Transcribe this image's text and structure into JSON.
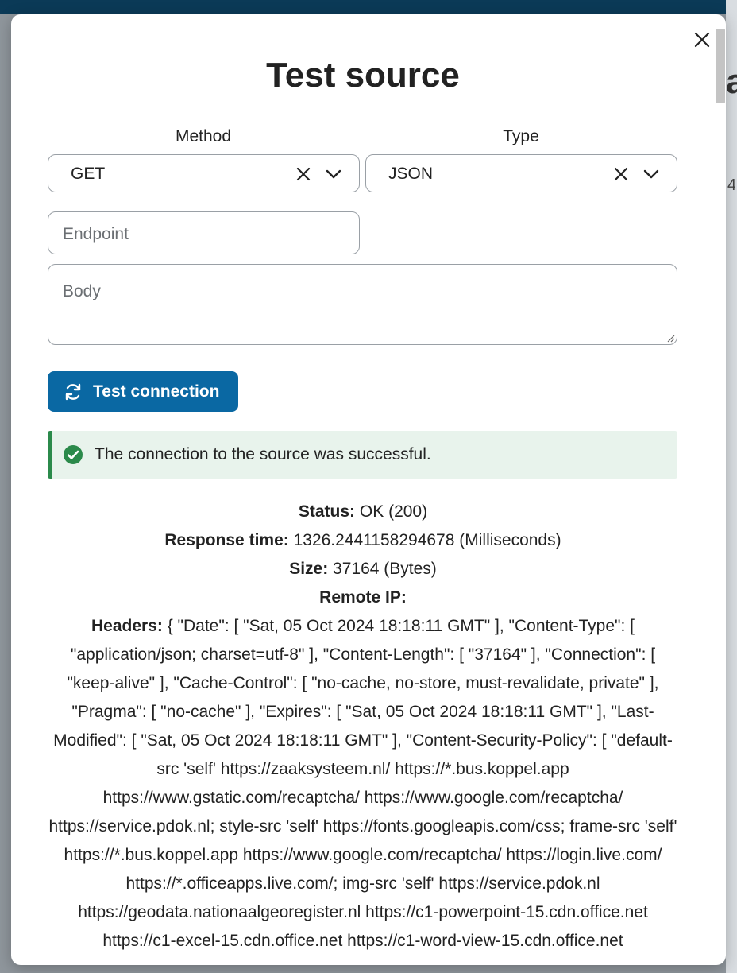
{
  "modal": {
    "title": "Test source"
  },
  "form": {
    "method": {
      "label": "Method",
      "value": "GET"
    },
    "type": {
      "label": "Type",
      "value": "JSON"
    },
    "endpoint": {
      "placeholder": "Endpoint"
    },
    "body": {
      "placeholder": "Body"
    },
    "test_button_label": "Test connection"
  },
  "alert": {
    "message": "The connection to the source was successful.",
    "color": "#2b8a4b"
  },
  "result": {
    "status_label": "Status:",
    "status_value": "OK (200)",
    "response_time_label": "Response time:",
    "response_time_value": "1326.2441158294678 (Milliseconds)",
    "size_label": "Size:",
    "size_value": "37164 (Bytes)",
    "remote_ip_label": "Remote IP:",
    "remote_ip_value": "",
    "headers_label": "Headers:",
    "headers_value": "{ \"Date\": [ \"Sat, 05 Oct 2024 18:18:11 GMT\" ], \"Content-Type\": [ \"application/json; charset=utf-8\" ], \"Content-Length\": [ \"37164\" ], \"Connection\": [ \"keep-alive\" ], \"Cache-Control\": [ \"no-cache, no-store, must-revalidate, private\" ], \"Pragma\": [ \"no-cache\" ], \"Expires\": [ \"Sat, 05 Oct 2024 18:18:11 GMT\" ], \"Last-Modified\": [ \"Sat, 05 Oct 2024 18:18:11 GMT\" ], \"Content-Security-Policy\": [ \"default-src 'self' https://zaaksysteem.nl/ https://*.bus.koppel.app https://www.gstatic.com/recaptcha/ https://www.google.com/recaptcha/ https://service.pdok.nl; style-src 'self' https://fonts.googleapis.com/css; frame-src 'self' https://*.bus.koppel.app https://www.google.com/recaptcha/ https://login.live.com/ https://*.officeapps.live.com/; img-src 'self' https://service.pdok.nl https://geodata.nationaalgeoregister.nl https://c1-powerpoint-15.cdn.office.net https://c1-excel-15.cdn.office.net https://c1-word-view-15.cdn.office.net"
  },
  "colors": {
    "primary": "#0a68a3",
    "success": "#2b8a4b",
    "alert_bg": "#e8f3ec"
  },
  "icons": {
    "close": "close-icon",
    "clear": "clear-icon",
    "chevron": "chevron-down-icon",
    "refresh": "refresh-icon",
    "success": "check-circle-icon"
  }
}
